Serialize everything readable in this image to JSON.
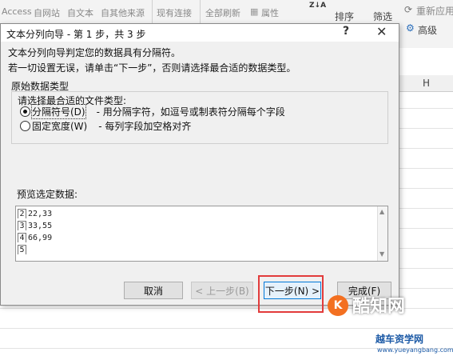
{
  "ribbon": {
    "left_items": [
      "Access",
      "自网站",
      "自文本",
      "自其他来源"
    ],
    "connections": "现有连接",
    "refresh_all": "全部刷新",
    "properties": "属性",
    "sort": "排序",
    "filter": "筛选",
    "reapply": "重新应用",
    "advanced": "高级",
    "sort_za": "Z↓A"
  },
  "sheet": {
    "col_h": "H"
  },
  "dialog": {
    "title": "文本分列向导 - 第 1 步，共 3 步",
    "help": "?",
    "close": "✕",
    "intro1": "文本分列向导判定您的数据具有分隔符。",
    "intro2": "若一切设置无误，请单击“下一步”，否则请选择最合适的数据类型。",
    "group_title": "原始数据类型",
    "choose_label": "请选择最合适的文件类型:",
    "options": [
      {
        "label": "分隔符号(D)",
        "desc": "- 用分隔字符，如逗号或制表符分隔每个字段",
        "selected": true
      },
      {
        "label": "固定宽度(W)",
        "desc": "- 每列字段加空格对齐",
        "selected": false
      }
    ],
    "preview_label": "预览选定数据:",
    "preview_rows": [
      {
        "num": "2",
        "text": "22,33"
      },
      {
        "num": "3",
        "text": "33,55"
      },
      {
        "num": "4",
        "text": "66,99"
      },
      {
        "num": "5",
        "text": ""
      }
    ],
    "buttons": {
      "cancel": "取消",
      "back": "< 上一步(B)",
      "next": "下一步(N) >",
      "finish": "完成(F)"
    }
  },
  "watermark": {
    "logo": "K",
    "text": "酷知网",
    "brand": "越车资学网",
    "url": "www.yueyangbang.com"
  }
}
